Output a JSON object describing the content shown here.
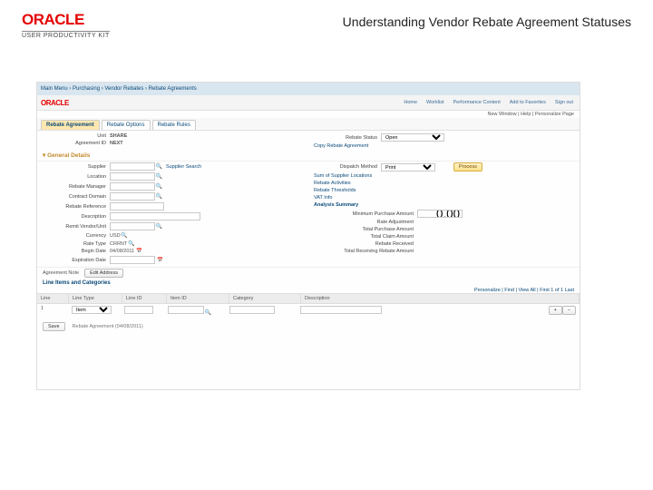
{
  "header": {
    "logo": "ORACLE",
    "upk": "USER PRODUCTIVITY KIT",
    "title": "Understanding Vendor Rebate Agreement Statuses"
  },
  "screenshot": {
    "breadcrumb": "Main Menu  ›  Purchasing  ›  Vendor Rebates  ›  Rebate Agreements",
    "app_logo": "ORACLE",
    "gnav": [
      "Home",
      "Worklist",
      "Performance Content",
      "Add to Favorites",
      "Sign out"
    ],
    "userline": "New Window | Help | Personalize Page",
    "tabs": [
      "Rebate Agreement",
      "Rebate Options",
      "Rebate Rules"
    ],
    "left_fields": {
      "unit": "Unit",
      "unit_val": "SHARE",
      "agr_id": "Agreement ID",
      "agr_id_val": "NEXT",
      "supplier": "Supplier",
      "supplier_search": "Supplier Search",
      "location": "Location",
      "rebate_mgr": "Rebate Manager",
      "contact": "Contract Domain",
      "rebate_ref": "Rebate Reference",
      "description": "Description",
      "remit_v": "Remit Vendor/Unit",
      "currency": "Currency",
      "currency_val": "USD",
      "rate_type": "Rate Type",
      "rate_type_val": "CRRNT",
      "begin_date": "Begin Date",
      "begin_date_val": "04/08/2011",
      "expire_date": "Expiration Date"
    },
    "right_fields": {
      "status": "Rebate Status",
      "status_val": "Open",
      "action_btn": "Process",
      "dispatch": "Dispatch Method",
      "dispatch_val": "Print",
      "copy_link": "Copy Rebate Agreement",
      "sum_sup": "Sum of Supplier Locations",
      "act": "Rebate Activities",
      "thr": "Rebate Thresholds",
      "vat": "VAT Info",
      "analysis": "Analysis Summary",
      "min_amt": "Minimum Purchase Amount",
      "min_amt_val": "0.00",
      "rate_adj": "Rate Adjustment",
      "tot_purch": "Total Purchase Amount",
      "tot_claim": "Total Claim Amount",
      "rebate_rec": "Rebate Received",
      "tot_rebate": "Total Receiving Rebate Amount"
    },
    "ag_note": "Agreement Note",
    "ag_note_btn": "Edit Address",
    "lines": {
      "title": "Line Items and Categories",
      "cols": [
        "Line",
        "Line Type",
        "Line ID",
        "Item ID",
        "Category",
        "Description"
      ],
      "pager": "Personalize | Find | View All  |  First 1 of 1 Last",
      "row": {
        "line": "1",
        "type": "Item",
        "line_id": "",
        "item_id": "",
        "category": "",
        "desc": ""
      },
      "add": "+",
      "del": "−"
    },
    "footer": {
      "save": "Save",
      "info": "Rebate Agreement (04/08/2011)"
    }
  }
}
